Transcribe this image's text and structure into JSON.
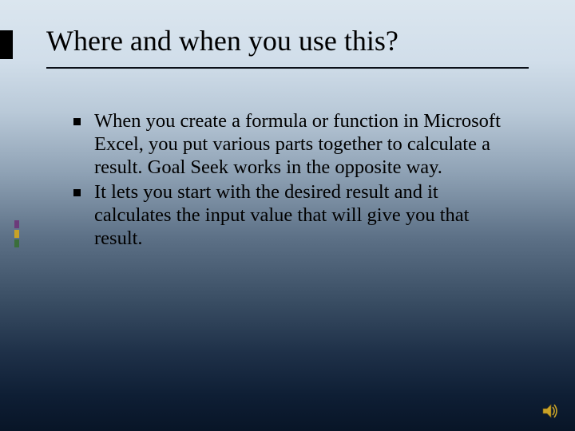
{
  "slide": {
    "title": "Where and when you use this?",
    "bullets": [
      "When you create a formula or function in Microsoft Excel, you put various parts together to calculate a result. Goal Seek works in the opposite way.",
      "It lets you start with the desired result and it calculates the input value that will give you that result."
    ]
  },
  "icons": {
    "sound": "sound-icon"
  }
}
